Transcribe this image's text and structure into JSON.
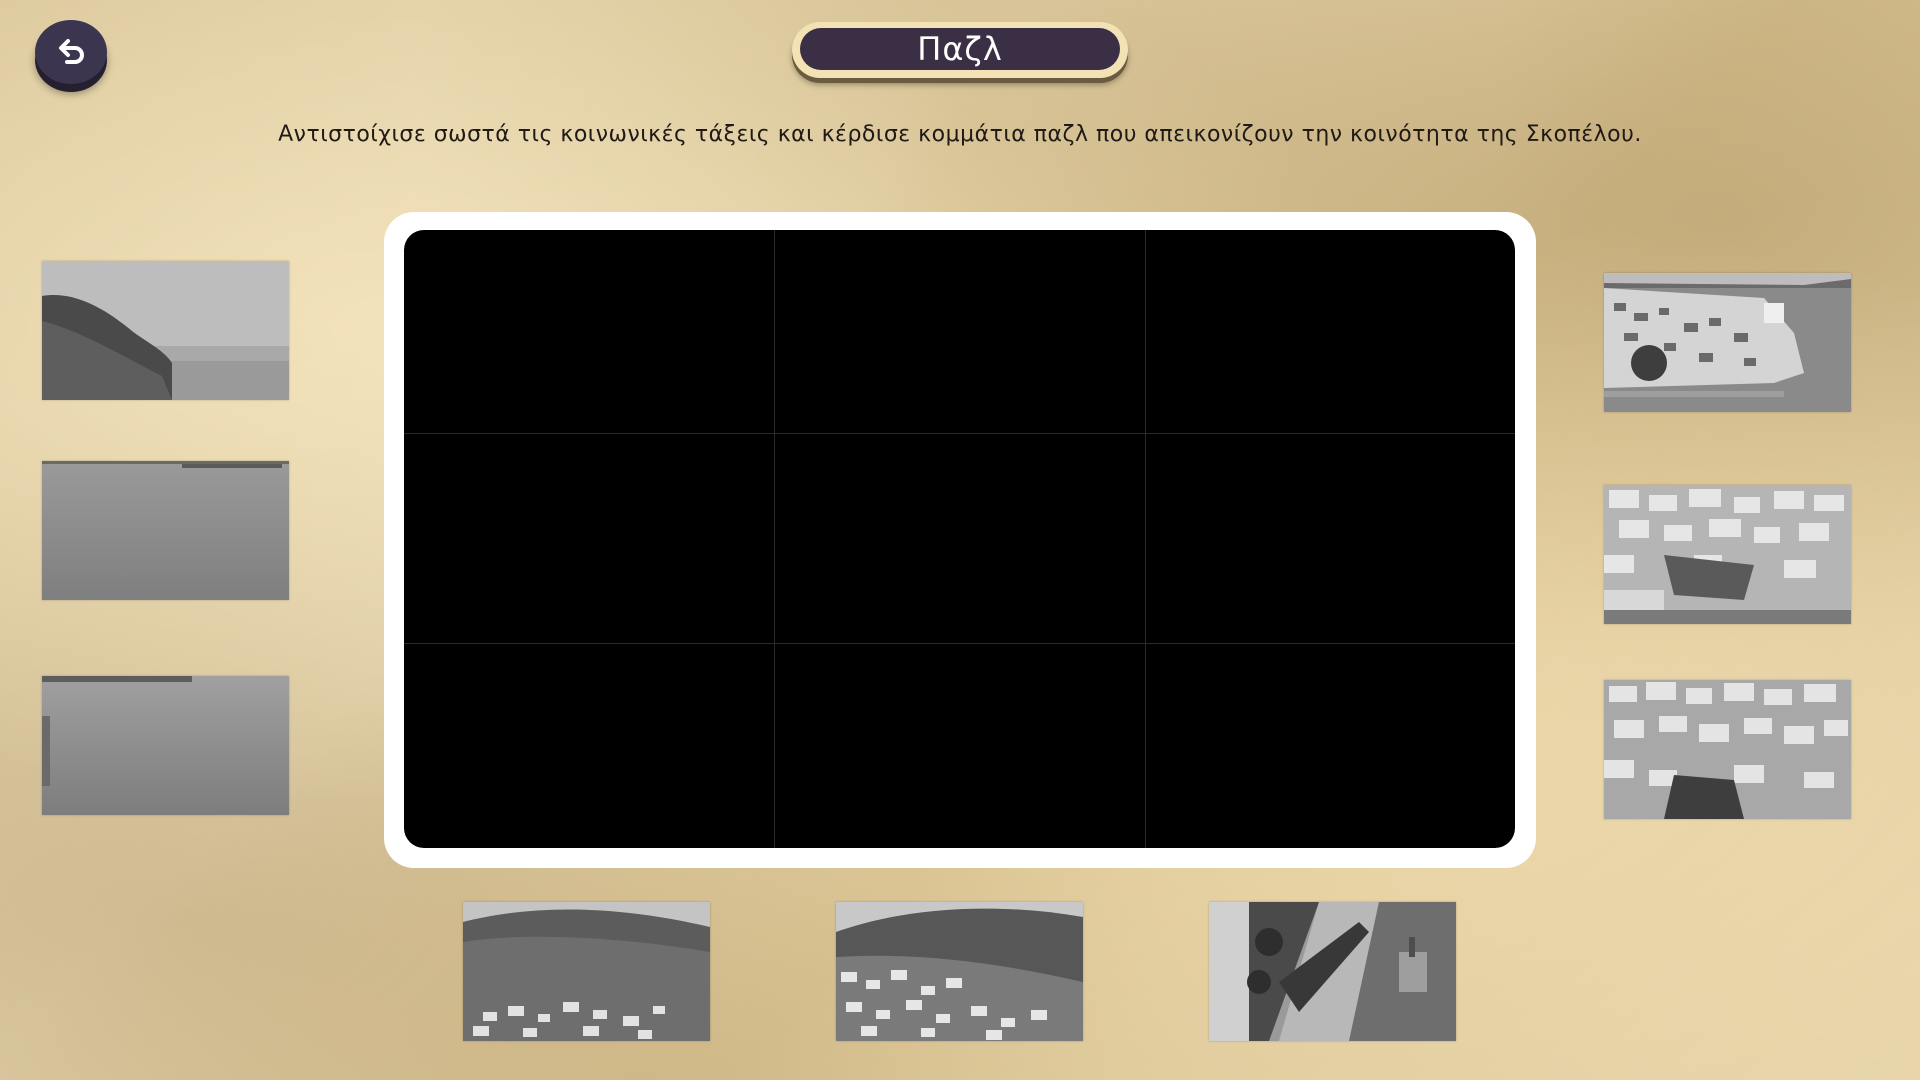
{
  "header": {
    "title": "Παζλ",
    "back_button_icon": "undo-arrow-icon"
  },
  "instructions": "Αντιστοίχισε σωστά τις κοινωνικές τάξεις και κέρδισε κομμάτια παζλ που απεικονίζουν την κοινότητα της Σκοπέλου.",
  "board": {
    "rows": 3,
    "columns": 3,
    "filled_slots": 0
  },
  "pieces": [
    {
      "id": "left-1",
      "depicts": "coastline-hill-sea"
    },
    {
      "id": "left-2",
      "depicts": "harbor-water-breakwater"
    },
    {
      "id": "left-3",
      "depicts": "harbor-water"
    },
    {
      "id": "right-1",
      "depicts": "town-waterfront-church"
    },
    {
      "id": "right-2",
      "depicts": "town-houses-shore"
    },
    {
      "id": "right-3",
      "depicts": "town-houses"
    },
    {
      "id": "bottom-1",
      "depicts": "hillside-town"
    },
    {
      "id": "bottom-2",
      "depicts": "hillside-town"
    },
    {
      "id": "bottom-3",
      "depicts": "waterfront-promenade"
    }
  ],
  "colors": {
    "title_pill_bg": "#3a2f44",
    "title_pill_border": "#f3e2b4",
    "board_bg": "#000000",
    "board_frame": "#ffffff"
  }
}
